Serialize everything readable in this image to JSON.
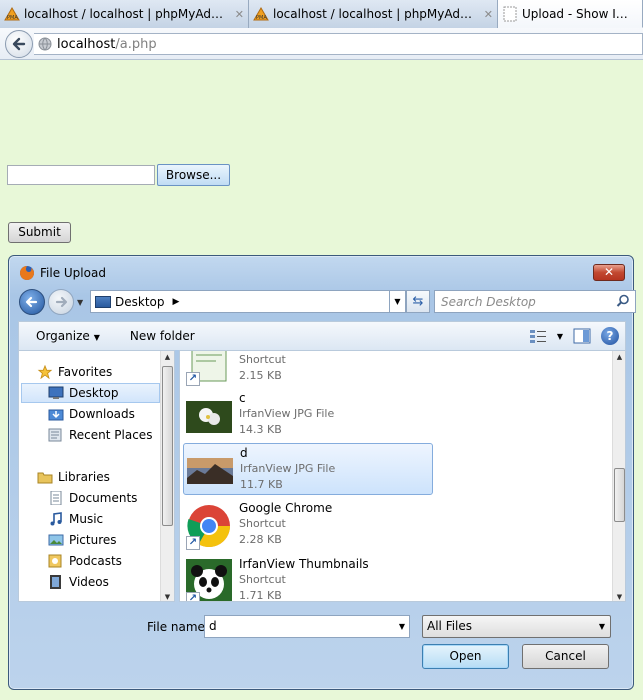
{
  "browser": {
    "tabs": [
      {
        "title": "localhost / localhost | phpMyAdmin ...",
        "close": "✕"
      },
      {
        "title": "localhost / localhost | phpMyAdmin ...",
        "close": "✕"
      },
      {
        "title": "Upload - Show Image",
        "close": ""
      }
    ],
    "url_host": "localhost",
    "url_path": "/a.php"
  },
  "page": {
    "browse_label": "Browse...",
    "submit_label": "Submit"
  },
  "dialog": {
    "title": "File Upload",
    "close_label": "✕",
    "breadcrumb": "Desktop",
    "search_placeholder": "Search Desktop",
    "toolbar": {
      "organize": "Organize",
      "new_folder": "New folder"
    },
    "nav": {
      "favorites_header": "Favorites",
      "favorites": [
        "Desktop",
        "Downloads",
        "Recent Places"
      ],
      "libraries_header": "Libraries",
      "libraries": [
        "Documents",
        "Music",
        "Pictures",
        "Podcasts",
        "Videos"
      ]
    },
    "files": [
      {
        "name": "",
        "type": "Shortcut",
        "size": "2.15 KB",
        "icon": "document-shortcut-icon",
        "shortcut": true
      },
      {
        "name": "c",
        "type": "IrfanView JPG File",
        "size": "14.3 KB",
        "icon": "flower-image-icon",
        "shortcut": false
      },
      {
        "name": "d",
        "type": "IrfanView JPG File",
        "size": "11.7 KB",
        "icon": "landscape-image-icon",
        "shortcut": false,
        "selected": true
      },
      {
        "name": "Google Chrome",
        "type": "Shortcut",
        "size": "2.28 KB",
        "icon": "chrome-icon",
        "shortcut": true
      },
      {
        "name": "IrfanView Thumbnails",
        "type": "Shortcut",
        "size": "1.71 KB",
        "icon": "panda-icon",
        "shortcut": true
      }
    ],
    "file_name_label": "File name:",
    "file_name_value": "d",
    "file_type": "All Files",
    "open_label": "Open",
    "cancel_label": "Cancel"
  },
  "colors": {
    "page_background": "#e8f8d8",
    "selection": "#cde3fc"
  }
}
